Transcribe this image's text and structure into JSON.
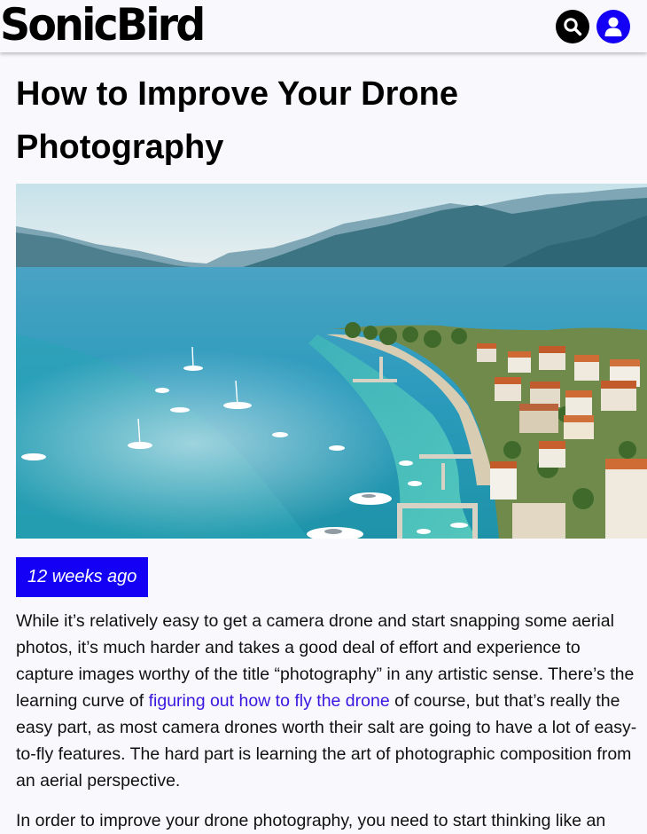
{
  "header": {
    "logo_text": "SonicBird",
    "search_icon": "search-icon",
    "account_icon": "user-icon"
  },
  "article": {
    "title": "How to Improve Your Drone Photography",
    "date_badge": "12 weeks ago",
    "paragraph1": {
      "before_link": "While it’s relatively easy to get a camera drone and start snapping some aerial photos, it’s much harder and takes a good deal of effort and experience to capture images worthy of the title “photography” in any artistic sense. There’s the learning curve of ",
      "link_text": "figuring out how to fly the drone",
      "after_link": " of course, but that’s really the easy part, as most camera drones worth their salt are going to have a lot of easy-to-fly features. The hard part is learning the art of photographic composition from an aerial perspective."
    },
    "paragraph2_start": "In order to improve your drone photography, you need to start thinking like an"
  },
  "colors": {
    "accent": "#1400f5",
    "link": "#3a16e0",
    "background": "#f9f9fd"
  }
}
